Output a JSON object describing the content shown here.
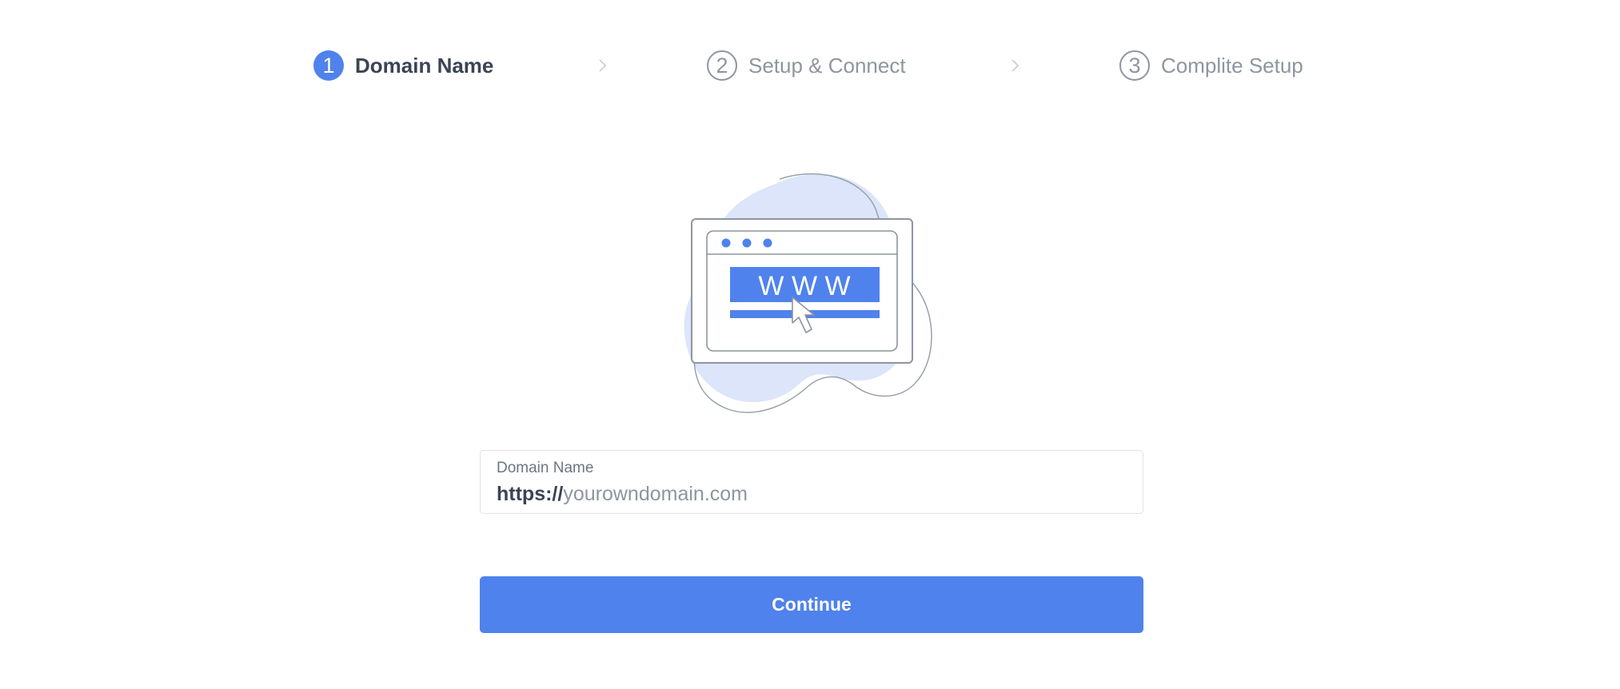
{
  "stepper": {
    "steps": [
      {
        "number": "1",
        "label": "Domain Name",
        "state": "active"
      },
      {
        "number": "2",
        "label": "Setup & Connect",
        "state": "inactive"
      },
      {
        "number": "3",
        "label": "Complite Setup",
        "state": "inactive"
      }
    ]
  },
  "illustration": {
    "text": "W W W"
  },
  "domain_field": {
    "label": "Domain Name",
    "prefix": "https://",
    "value": "",
    "placeholder": "yourowndomain.com"
  },
  "continue_button": {
    "label": "Continue"
  },
  "colors": {
    "accent": "#4f82ec",
    "text_dark": "#3b4454",
    "text_muted": "#8e959f",
    "blob": "#dce5fa"
  }
}
